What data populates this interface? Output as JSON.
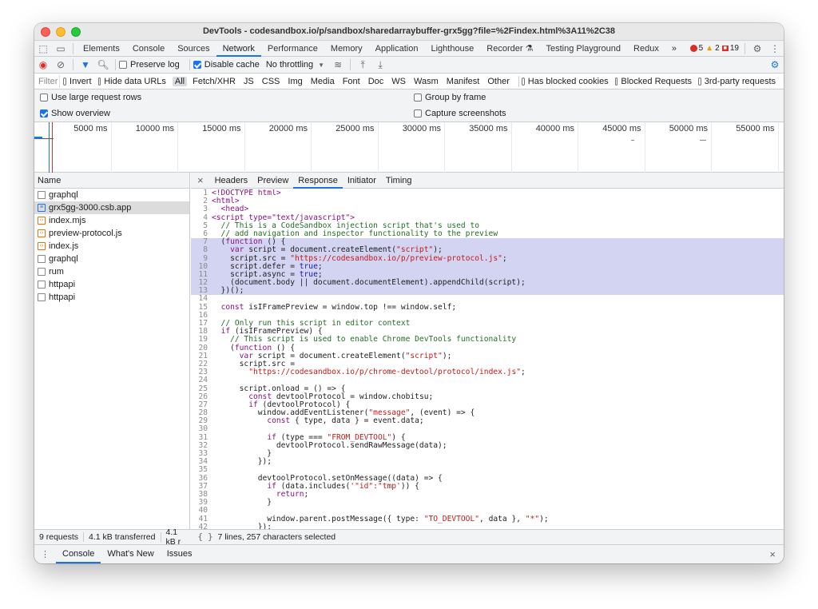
{
  "window": {
    "title": "DevTools - codesandbox.io/p/sandbox/sharedarraybuffer-grx5gg?file=%2Findex.html%3A11%2C38"
  },
  "tabs": {
    "items": [
      "Elements",
      "Console",
      "Sources",
      "Network",
      "Performance",
      "Memory",
      "Application",
      "Lighthouse",
      "Recorder ⚗",
      "Testing Playground",
      "Redux",
      "»"
    ],
    "active": "Network",
    "errors": "5",
    "warnings": "2",
    "issues": "19"
  },
  "toolbar": {
    "preserve_log": "Preserve log",
    "disable_cache": "Disable cache",
    "throttling": "No throttling"
  },
  "filter": {
    "placeholder": "Filter",
    "invert": "Invert",
    "hide_data_urls": "Hide data URLs",
    "types": [
      "All",
      "Fetch/XHR",
      "JS",
      "CSS",
      "Img",
      "Media",
      "Font",
      "Doc",
      "WS",
      "Wasm",
      "Manifest",
      "Other"
    ],
    "has_blocked": "Has blocked cookies",
    "blocked_requests": "Blocked Requests",
    "third_party": "3rd-party requests"
  },
  "options": {
    "large_rows": "Use large request rows",
    "group_by_frame": "Group by frame",
    "show_overview": "Show overview",
    "capture_screenshots": "Capture screenshots"
  },
  "timeline": {
    "ticks": [
      "5000 ms",
      "10000 ms",
      "15000 ms",
      "20000 ms",
      "25000 ms",
      "30000 ms",
      "35000 ms",
      "40000 ms",
      "45000 ms",
      "50000 ms",
      "55000 ms"
    ]
  },
  "requests": {
    "header": "Name",
    "items": [
      {
        "name": "graphql",
        "type": "other"
      },
      {
        "name": "grx5gg-3000.csb.app",
        "type": "doc"
      },
      {
        "name": "index.mjs",
        "type": "js"
      },
      {
        "name": "preview-protocol.js",
        "type": "js"
      },
      {
        "name": "index.js",
        "type": "js"
      },
      {
        "name": "graphql",
        "type": "other"
      },
      {
        "name": "rum",
        "type": "other"
      },
      {
        "name": "httpapi",
        "type": "other"
      },
      {
        "name": "httpapi",
        "type": "other"
      }
    ]
  },
  "detail": {
    "tabs": [
      "Headers",
      "Preview",
      "Response",
      "Initiator",
      "Timing"
    ],
    "active": "Response"
  },
  "code": [
    {
      "n": "1",
      "t": "<!DOCTYPE html>",
      "h": false
    },
    {
      "n": "2",
      "t": "<html>",
      "h": false
    },
    {
      "n": "3",
      "t": "  <head>",
      "h": false
    },
    {
      "n": "4",
      "t": "<script type=\"text/javascript\">",
      "h": false
    },
    {
      "n": "5",
      "t": "  // This is a CodeSandbox injection script that's used to",
      "h": false
    },
    {
      "n": "6",
      "t": "  // add navigation and inspector functionality to the preview",
      "h": false
    },
    {
      "n": "7",
      "t": "  (function () {",
      "h": true
    },
    {
      "n": "8",
      "t": "    var script = document.createElement(\"script\");",
      "h": true
    },
    {
      "n": "9",
      "t": "    script.src = \"https://codesandbox.io/p/preview-protocol.js\";",
      "h": true
    },
    {
      "n": "10",
      "t": "    script.defer = true;",
      "h": true
    },
    {
      "n": "11",
      "t": "    script.async = true;",
      "h": true
    },
    {
      "n": "12",
      "t": "    (document.body || document.documentElement).appendChild(script);",
      "h": true
    },
    {
      "n": "13",
      "t": "  })();",
      "h": true
    },
    {
      "n": "14",
      "t": "",
      "h": false
    },
    {
      "n": "15",
      "t": "  const isIFramePreview = window.top !== window.self;",
      "h": false
    },
    {
      "n": "16",
      "t": "",
      "h": false
    },
    {
      "n": "17",
      "t": "  // Only run this script in editor context",
      "h": false
    },
    {
      "n": "18",
      "t": "  if (isIFramePreview) {",
      "h": false
    },
    {
      "n": "19",
      "t": "    // This script is used to enable Chrome DevTools functionality",
      "h": false
    },
    {
      "n": "20",
      "t": "    (function () {",
      "h": false
    },
    {
      "n": "21",
      "t": "      var script = document.createElement(\"script\");",
      "h": false
    },
    {
      "n": "22",
      "t": "      script.src =",
      "h": false
    },
    {
      "n": "23",
      "t": "        \"https://codesandbox.io/p/chrome-devtool/protocol/index.js\";",
      "h": false
    },
    {
      "n": "24",
      "t": "",
      "h": false
    },
    {
      "n": "25",
      "t": "      script.onload = () => {",
      "h": false
    },
    {
      "n": "26",
      "t": "        const devtoolProtocol = window.chobitsu;",
      "h": false
    },
    {
      "n": "27",
      "t": "        if (devtoolProtocol) {",
      "h": false
    },
    {
      "n": "28",
      "t": "          window.addEventListener(\"message\", (event) => {",
      "h": false
    },
    {
      "n": "29",
      "t": "            const { type, data } = event.data;",
      "h": false
    },
    {
      "n": "30",
      "t": "",
      "h": false
    },
    {
      "n": "31",
      "t": "            if (type === \"FROM_DEVTOOL\") {",
      "h": false
    },
    {
      "n": "32",
      "t": "              devtoolProtocol.sendRawMessage(data);",
      "h": false
    },
    {
      "n": "33",
      "t": "            }",
      "h": false
    },
    {
      "n": "34",
      "t": "          });",
      "h": false
    },
    {
      "n": "35",
      "t": "",
      "h": false
    },
    {
      "n": "36",
      "t": "          devtoolProtocol.setOnMessage((data) => {",
      "h": false
    },
    {
      "n": "37",
      "t": "            if (data.includes('\"id\":\"tmp')) {",
      "h": false
    },
    {
      "n": "38",
      "t": "              return;",
      "h": false
    },
    {
      "n": "39",
      "t": "            }",
      "h": false
    },
    {
      "n": "40",
      "t": "",
      "h": false
    },
    {
      "n": "41",
      "t": "            window.parent.postMessage({ type: \"TO_DEVTOOL\", data }, \"*\");",
      "h": false
    },
    {
      "n": "42",
      "t": "          });",
      "h": false
    }
  ],
  "status": {
    "requests": "9 requests",
    "transferred": "4.1 kB transferred",
    "resources": "4.1 kB r",
    "selection": "7 lines, 257 characters selected"
  },
  "drawer": {
    "tabs": [
      "Console",
      "What's New",
      "Issues"
    ],
    "active": "Console"
  }
}
